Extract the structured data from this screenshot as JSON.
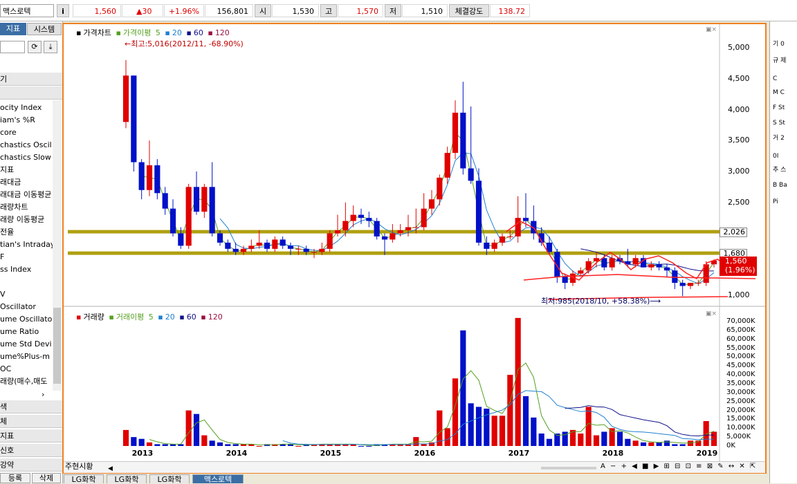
{
  "topbar": {
    "stock_name": "맥스로텍",
    "info_button": "i",
    "price": "1,560",
    "change": "▲30",
    "change_pct": "+1.96%",
    "volume": "156,801",
    "open_label": "시",
    "open": "1,530",
    "high_label": "고",
    "high": "1,570",
    "low_label": "저",
    "low": "1,510",
    "strength_label": "체결강도",
    "strength": "138.72"
  },
  "left_panel": {
    "tabs": [
      "지표",
      "시스템"
    ],
    "section_top": "기",
    "indicators": [
      "ocity Index",
      "iam's %R",
      "core",
      "chastics Oscil",
      "chastics Slow",
      "지표",
      "래대금",
      "래대금 이동평균",
      "래량차트",
      "래량 이동평균",
      "전율",
      "tian's Intraday",
      "F",
      "ss Index",
      "",
      "V",
      "Oscillator",
      "ume Oscillato",
      "ume Ratio",
      "ume Std Devi",
      "ume%Plus-m",
      "OC",
      "래량(매수,매도"
    ],
    "sections": [
      "색",
      "체",
      "지표",
      "신호",
      "강약"
    ],
    "buttons": [
      "등록",
      "삭제"
    ]
  },
  "right_strip": {
    "items": [
      "기 0",
      "규 제",
      "C",
      "M C",
      "F St",
      "S St",
      "거 2",
      "0I",
      "추 스",
      "B Ba",
      "Pi"
    ]
  },
  "price_legend": {
    "title": "가격차트",
    "ma_label": "가격이평",
    "periods": [
      "5",
      "20",
      "60",
      "120"
    ]
  },
  "volume_legend": {
    "title": "거래량",
    "ma_label": "거래이평",
    "periods": [
      "5",
      "20",
      "60",
      "120"
    ]
  },
  "annotations": {
    "high": "←최고:5,016(2012/11, -68.90%)",
    "low": "최저:985(2018/10, +58.38%)⟶"
  },
  "price_axis": [
    "5,000",
    "4,500",
    "4,000",
    "3,500",
    "3,000",
    "2,500",
    "1,000"
  ],
  "volume_axis": [
    "70,000K",
    "65,000K",
    "60,000K",
    "55,000K",
    "50,000K",
    "45,000K",
    "40,000K",
    "35,000K",
    "30,000K",
    "25,000K",
    "20,000K",
    "15,000K",
    "10,000K",
    "5,000K",
    "0K"
  ],
  "markers": {
    "line_2026": "2,026",
    "line_1680": "1,680",
    "current_price": "1,560",
    "current_pct": "(1.96%)"
  },
  "bottom_buttons": [
    "주",
    "현",
    "시",
    "황"
  ],
  "bottom_tabs": [
    "LG화학",
    "LG화학",
    "LG화학",
    "맥스로텍"
  ],
  "colors": {
    "up": "#e00000",
    "down": "#0010c8",
    "accent": "#f08020",
    "hline": "#b0a010"
  },
  "chart_data": {
    "type": "bar",
    "title": "가격차트",
    "x": [
      "2012/11",
      "2012/12",
      "2013/01",
      "2013/02",
      "2013/03",
      "2013/04",
      "2013/05",
      "2013/06",
      "2013/07",
      "2013/08",
      "2013/09",
      "2013/10",
      "2013/11",
      "2013/12",
      "2014/01",
      "2014/02",
      "2014/03",
      "2014/04",
      "2014/05",
      "2014/06",
      "2014/07",
      "2014/08",
      "2014/09",
      "2014/10",
      "2014/11",
      "2014/12",
      "2015/01",
      "2015/02",
      "2015/03",
      "2015/04",
      "2015/05",
      "2015/06",
      "2015/07",
      "2015/08",
      "2015/09",
      "2015/10",
      "2015/11",
      "2015/12",
      "2016/01",
      "2016/02",
      "2016/03",
      "2016/04",
      "2016/05",
      "2016/06",
      "2016/07",
      "2016/08",
      "2016/09",
      "2016/10",
      "2016/11",
      "2016/12",
      "2017/01",
      "2017/02",
      "2017/03",
      "2017/04",
      "2017/05",
      "2017/06",
      "2017/07",
      "2017/08",
      "2017/09",
      "2017/10",
      "2017/11",
      "2017/12",
      "2018/01",
      "2018/02",
      "2018/03",
      "2018/04",
      "2018/05",
      "2018/06",
      "2018/07",
      "2018/08",
      "2018/09",
      "2018/10",
      "2018/11",
      "2018/12",
      "2019/01",
      "2019/02"
    ],
    "xticks": [
      "2013",
      "2014",
      "2015",
      "2016",
      "2017",
      "2018",
      "2019"
    ],
    "series": [
      {
        "name": "open",
        "values": [
          3800,
          4550,
          3150,
          2700,
          3100,
          2650,
          2400,
          2000,
          1800,
          2750,
          2350,
          2750,
          2000,
          1850,
          1750,
          1700,
          1750,
          1800,
          1850,
          1750,
          1900,
          1800,
          1750,
          1750,
          1700,
          1700,
          1750,
          2000,
          2050,
          2200,
          2300,
          2250,
          2200,
          1950,
          1900,
          2000,
          2050,
          2100,
          2100,
          2400,
          2550,
          2900,
          3300,
          3950,
          3050,
          2850,
          1850,
          1750,
          1850,
          1950,
          1950,
          2250,
          2200,
          2000,
          1850,
          1700,
          1300,
          1200,
          1350,
          1400,
          1550,
          1600,
          1450,
          1600,
          1550,
          1500,
          1600,
          1450,
          1500,
          1450,
          1400,
          1200,
          1150,
          1200,
          1200,
          1500
        ]
      },
      {
        "name": "close",
        "values": [
          4550,
          3150,
          2700,
          3100,
          2650,
          2400,
          2000,
          1800,
          2750,
          2350,
          2750,
          2000,
          1850,
          1750,
          1700,
          1750,
          1800,
          1850,
          1750,
          1900,
          1800,
          1750,
          1750,
          1700,
          1700,
          1750,
          2000,
          2050,
          2200,
          2300,
          2250,
          2200,
          1950,
          1900,
          2000,
          2050,
          2100,
          2100,
          2400,
          2550,
          2900,
          3300,
          3950,
          3050,
          2850,
          1850,
          1750,
          1850,
          1950,
          1950,
          2250,
          2200,
          2000,
          1850,
          1700,
          1300,
          1200,
          1350,
          1400,
          1550,
          1600,
          1450,
          1600,
          1550,
          1500,
          1600,
          1450,
          1500,
          1450,
          1400,
          1200,
          1150,
          1200,
          1200,
          1500,
          1560
        ]
      },
      {
        "name": "high",
        "values": [
          4800,
          4550,
          3200,
          3500,
          3200,
          2750,
          2550,
          2100,
          2800,
          3000,
          2800,
          3150,
          2050,
          1900,
          1850,
          1800,
          1900,
          2050,
          1900,
          1950,
          1950,
          1850,
          1800,
          1800,
          1750,
          1850,
          2050,
          2300,
          2500,
          2450,
          2400,
          2350,
          2250,
          2000,
          2150,
          2150,
          2300,
          2400,
          2650,
          2700,
          2950,
          3400,
          4150,
          4450,
          4050,
          3050,
          1950,
          1900,
          2000,
          2050,
          2600,
          2650,
          2450,
          2100,
          1950,
          1750,
          1350,
          1400,
          1450,
          1600,
          1700,
          1650,
          1650,
          1650,
          1750,
          1650,
          1650,
          1550,
          1550,
          1500,
          1450,
          1250,
          1200,
          1250,
          1550,
          1580
        ]
      },
      {
        "name": "low",
        "values": [
          3700,
          3000,
          2550,
          2600,
          2550,
          2300,
          1950,
          1750,
          1750,
          2300,
          2250,
          1950,
          1800,
          1700,
          1650,
          1650,
          1700,
          1750,
          1700,
          1700,
          1750,
          1650,
          1650,
          1650,
          1600,
          1650,
          1700,
          1950,
          1950,
          2100,
          2150,
          2100,
          1900,
          1650,
          1850,
          1950,
          1950,
          2000,
          2050,
          2300,
          2450,
          2800,
          3200,
          2950,
          2800,
          1800,
          1650,
          1700,
          1800,
          1900,
          1850,
          2100,
          1900,
          1800,
          1650,
          1200,
          1100,
          1150,
          1300,
          1350,
          1450,
          1400,
          1400,
          1500,
          1450,
          1450,
          1450,
          1400,
          1400,
          1300,
          1100,
          985,
          1100,
          1150,
          1150,
          1450
        ]
      },
      {
        "name": "거래량",
        "values": [
          9,
          5,
          4,
          2,
          1,
          1,
          1,
          1,
          20,
          18,
          6,
          3,
          2,
          1,
          1,
          1,
          1,
          0,
          1,
          1,
          1,
          1,
          0,
          1,
          1,
          1,
          1,
          1,
          1,
          1,
          0,
          0,
          1,
          1,
          1,
          1,
          1,
          5,
          1,
          2,
          20,
          10,
          38,
          65,
          24,
          22,
          21,
          17,
          17,
          40,
          72,
          28,
          16,
          7,
          4,
          7,
          8,
          9,
          7,
          22,
          6,
          8,
          10,
          8,
          4,
          3,
          2,
          2,
          2,
          3,
          1,
          1,
          3,
          3,
          14,
          8
        ]
      }
    ],
    "xlabel": "",
    "ylabel": "",
    "ylim": [
      985,
      5150
    ],
    "hlines": [
      2026,
      1680
    ]
  }
}
